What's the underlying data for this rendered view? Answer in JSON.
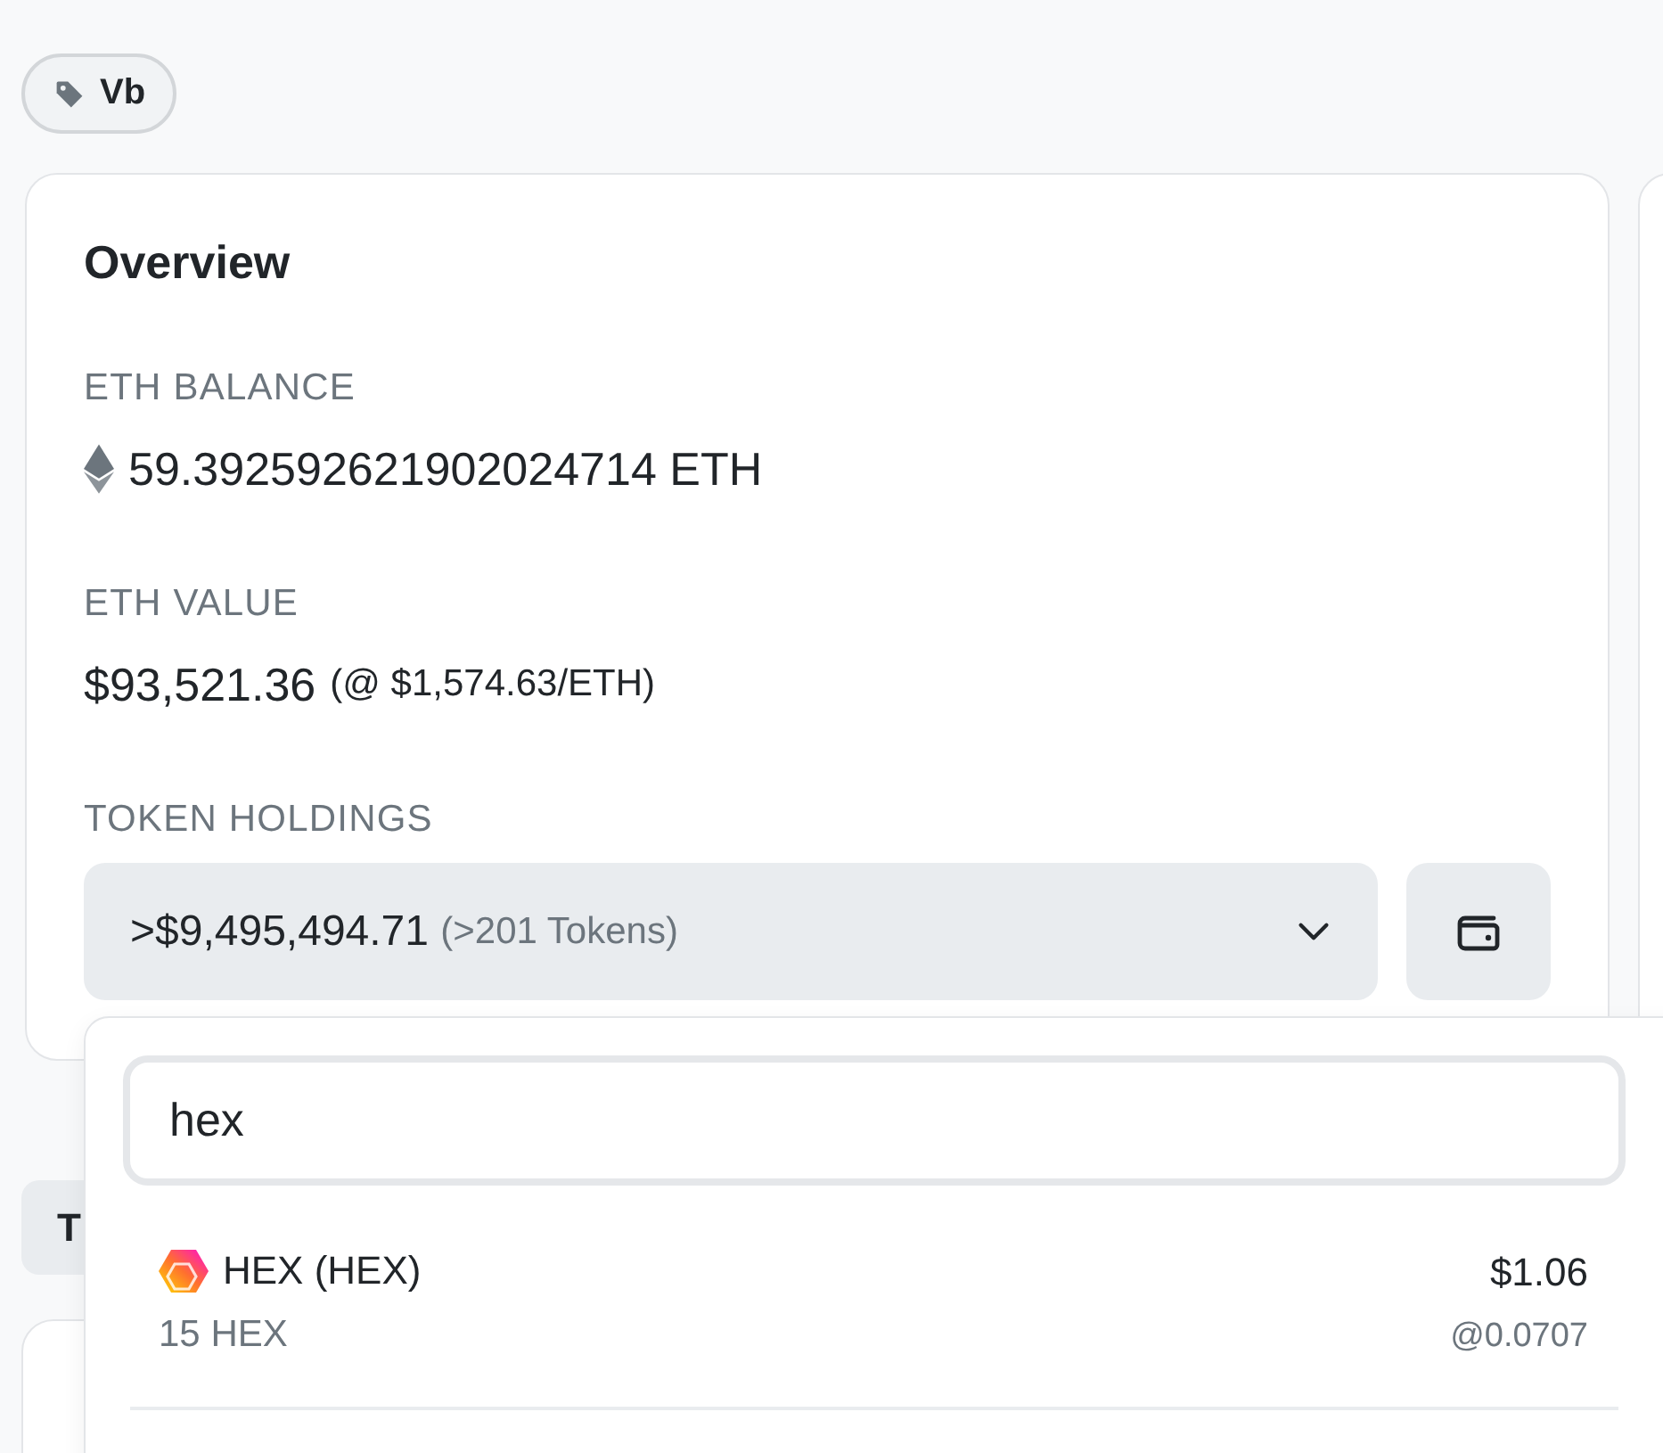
{
  "tag": {
    "label": "Vb"
  },
  "overview": {
    "title": "Overview",
    "eth_balance": {
      "label": "ETH BALANCE",
      "value": "59.392592621902024714 ETH"
    },
    "eth_value": {
      "label": "ETH VALUE",
      "value": "$93,521.36",
      "rate": "(@ $1,574.63/ETH)"
    },
    "token_holdings": {
      "label": "TOKEN HOLDINGS",
      "value": ">$9,495,494.71",
      "count": "(>201 Tokens)",
      "expanded": true
    }
  },
  "dropdown": {
    "search": {
      "value": "hex"
    },
    "tokens": [
      {
        "name": "HEX (HEX)",
        "amount": "15 HEX",
        "value": "$1.06",
        "price": "@0.0707"
      }
    ]
  },
  "tabs": [
    {
      "label": "T"
    }
  ]
}
